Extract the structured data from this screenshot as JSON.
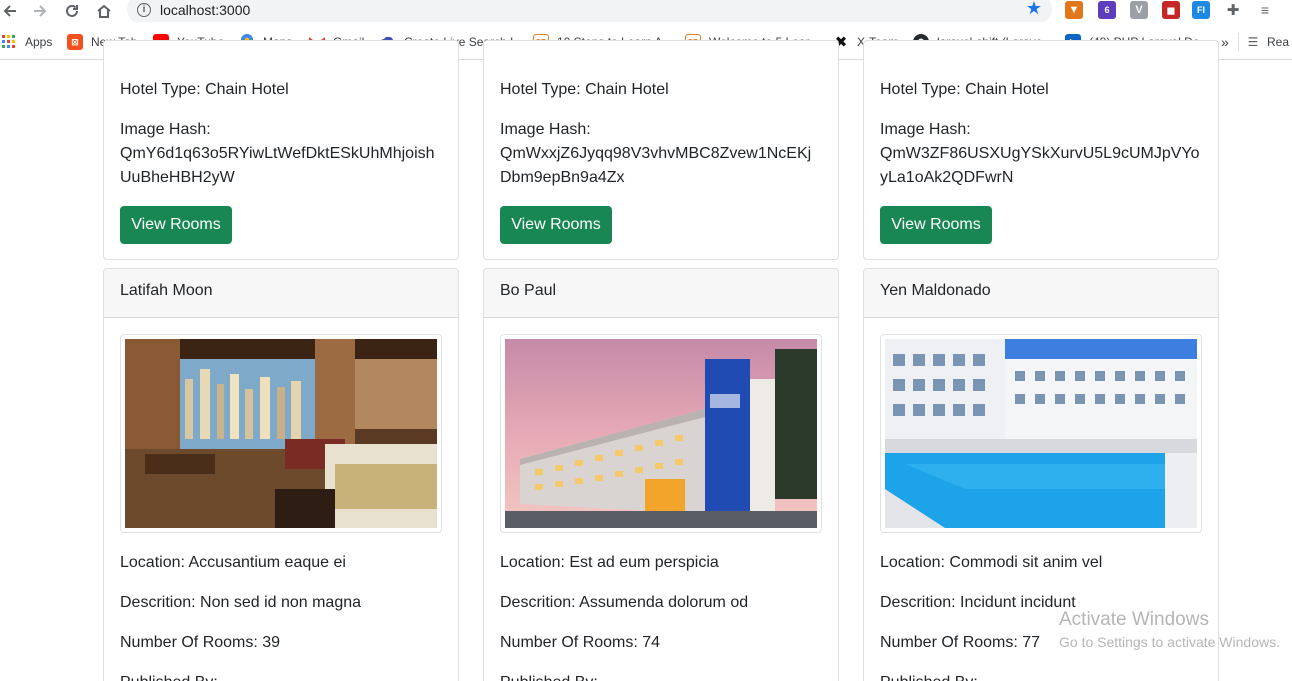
{
  "browser": {
    "url": "localhost:3000",
    "extension_badge": "6",
    "bookmarks": [
      {
        "label": "Apps",
        "icon": "apps-grid-icon"
      },
      {
        "label": "New Tab",
        "icon": "new-tab-icon"
      },
      {
        "label": "YouTube",
        "icon": "youtube-icon"
      },
      {
        "label": "Maps",
        "icon": "maps-pin-icon"
      },
      {
        "label": "Gmail",
        "icon": "gmail-icon"
      },
      {
        "label": "Create Live Search I...",
        "icon": "cloud-icon"
      },
      {
        "label": "10 Steps to Learn A...",
        "icon": "sp-icon"
      },
      {
        "label": "Welcome to 5 Lear...",
        "icon": "sp-icon"
      },
      {
        "label": "X-Team",
        "icon": "x-team-icon"
      },
      {
        "label": "laravel-shift (Larave...",
        "icon": "github-icon"
      },
      {
        "label": "(48) PHP Laravel De...",
        "icon": "linkedin-icon"
      },
      {
        "label": "Rea",
        "icon": "reading-list-icon"
      }
    ],
    "more_label": "»"
  },
  "top_cards": [
    {
      "hotel_type": "Hotel Type: Chain Hotel",
      "hash_label": "Image Hash:",
      "hash": "QmY6d1q63o5RYiwLtWefDktESkUhMhjoishUuBheHBH2yW",
      "button": "View Rooms"
    },
    {
      "hotel_type": "Hotel Type: Chain Hotel",
      "hash_label": "Image Hash:",
      "hash": "QmWxxjZ6Jyqq98V3vhvMBC8Zvew1NcEKjDbm9epBn9a4Zx",
      "button": "View Rooms"
    },
    {
      "hotel_type": "Hotel Type: Chain Hotel",
      "hash_label": "Image Hash:",
      "hash": "QmW3ZF86USXUgYSkXurvU5L9cUMJpVYoyLa1oAk2QDFwrN",
      "button": "View Rooms"
    }
  ],
  "hotels": [
    {
      "owner": "Latifah Moon",
      "image": "hotel-room-photo",
      "location": "Location: Accusantium eaque ei",
      "description": "Descrition: Non sed id non magna",
      "rooms": "Number Of Rooms: 39",
      "published": "Published By:"
    },
    {
      "owner": "Bo Paul",
      "image": "hotel-exterior-photo",
      "location": "Location: Est ad eum perspicia",
      "description": "Descrition: Assumenda dolorum od",
      "rooms": "Number Of Rooms: 74",
      "published": "Published By:"
    },
    {
      "owner": "Yen Maldonado",
      "image": "hotel-pool-photo",
      "location": "Location: Commodi sit anim vel",
      "description": "Descrition: Incidunt incidunt",
      "rooms": "Number Of Rooms: 77",
      "published": "Published By:"
    }
  ],
  "watermark": {
    "title": "Activate Windows",
    "subtitle": "Go to Settings to activate Windows."
  },
  "colors": {
    "button": "#198754",
    "accent": "#1a73e8"
  }
}
